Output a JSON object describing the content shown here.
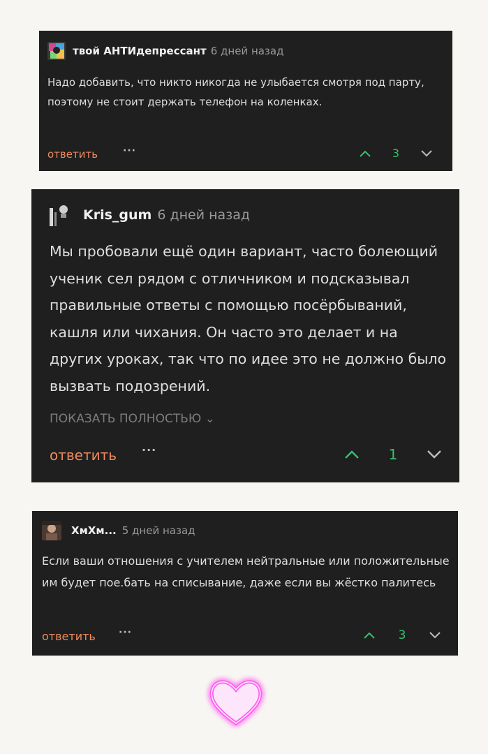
{
  "comments": [
    {
      "username": "твой АНТИдепрессант",
      "time": "6 дней назад",
      "text": "Надо добавить, что никто никогда не улыбается смотря под парту, поэтому не стоит держать телефон на коленках.",
      "reply_label": "ответить",
      "more_label": "···",
      "score": "3"
    },
    {
      "username": "Kris_gum",
      "time": "6 дней назад",
      "text": "Мы пробовали ещё один вариант, часто болеющий ученик сел рядом с отличником и подсказывал правильные ответы с помощью посёрбываний, кашля или чихания. Он часто это делает и на других уроках, так что по идее это не должно было вызвать подозрений.",
      "show_full_label": "ПОКАЗАТЬ ПОЛНОСТЬЮ ⌄",
      "reply_label": "ответить",
      "more_label": "···",
      "score": "1"
    },
    {
      "username": "ХмХм...",
      "time": "5 дней назад",
      "text": "Если ваши отношения с учителем нейтральные или положительные им будет пое.бать на списывание, даже если вы жёстко палитесь",
      "reply_label": "ответить",
      "more_label": "···",
      "score": "3"
    }
  ],
  "colors": {
    "card_bg": "#1f1f1f",
    "page_bg": "#f7f6f2",
    "reply": "#f08a5d",
    "upvote": "#36c16a",
    "heart_glow": "#ff5cf0"
  },
  "icons": [
    "upvote-arrow-icon",
    "downvote-arrow-icon",
    "more-dots-icon",
    "neon-heart-icon"
  ]
}
